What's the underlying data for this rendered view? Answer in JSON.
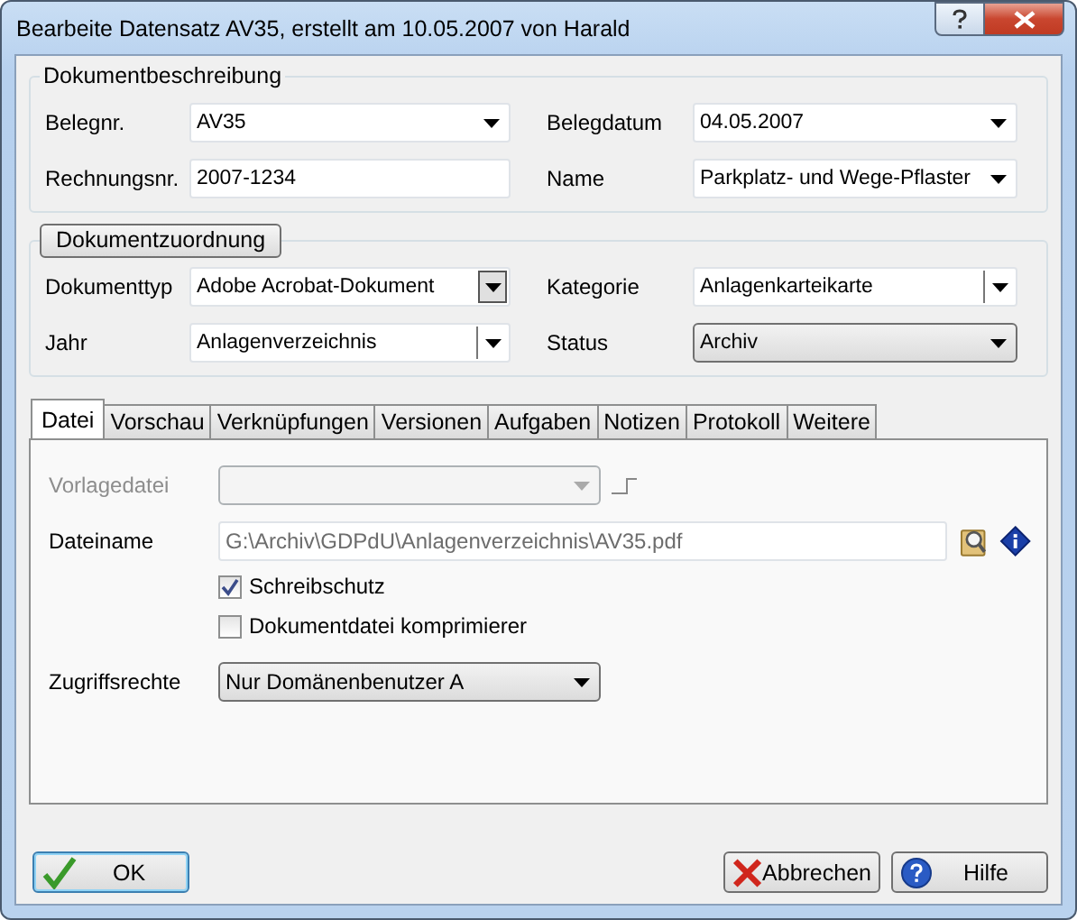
{
  "window": {
    "title": "Bearbeite Datensatz AV35, erstellt am 10.05.2007 von Harald"
  },
  "groups": [
    {
      "title": "Dokumentbeschreibung",
      "kind": "plain",
      "fields": [
        {
          "label": "Belegnr.",
          "value": "AV35",
          "kind": "combo"
        },
        {
          "label": "Belegdatum",
          "value": "04.05.2007",
          "kind": "combo"
        },
        {
          "label": "Rechnungsnr.",
          "value": "2007-1234",
          "kind": "text"
        },
        {
          "label": "Name",
          "value": "Parkplatz- und Wege-Pflaster",
          "kind": "combo"
        }
      ]
    },
    {
      "title": "Dokumentzuordnung",
      "kind": "button",
      "fields": [
        {
          "label": "Dokumenttyp",
          "value": "Adobe Acrobat-Dokument",
          "kind": "combo-pressed"
        },
        {
          "label": "Kategorie",
          "value": "Anlagenkarteikarte",
          "kind": "combo-split"
        },
        {
          "label": "Jahr",
          "value": "Anlagenverzeichnis",
          "kind": "combo-split"
        },
        {
          "label": "Status",
          "value": "Archiv",
          "kind": "dropdown"
        }
      ]
    }
  ],
  "tabs": [
    {
      "label": "Datei",
      "selected": true
    },
    {
      "label": "Vorschau",
      "selected": false
    },
    {
      "label": "Verknüpfungen",
      "selected": false
    },
    {
      "label": "Versionen",
      "selected": false
    },
    {
      "label": "Aufgaben",
      "selected": false
    },
    {
      "label": "Notizen",
      "selected": false
    },
    {
      "label": "Protokoll",
      "selected": false
    },
    {
      "label": "Weitere",
      "selected": false
    }
  ],
  "panel": {
    "template_file": {
      "label": "Vorlagedatei",
      "disabled": true
    },
    "file_name": {
      "label": "Dateiname",
      "value": "G:\\Archiv\\GDPdU\\Anlagenverzeichnis\\AV35.pdf",
      "readonly": true
    },
    "checkboxes": [
      {
        "label": "Schreibschutz",
        "checked": true
      },
      {
        "label": "Dokumentdatei komprimierer",
        "checked": false
      }
    ],
    "access_rights": {
      "label": "Zugriffsrechte",
      "value": "Nur Domänenbenutzer A"
    }
  },
  "buttons": [
    {
      "label": "OK",
      "kind": "ok",
      "default": true
    },
    {
      "label": "Abbrechen",
      "kind": "cancel",
      "default": false
    },
    {
      "label": "Hilfe",
      "kind": "help",
      "default": false
    }
  ]
}
